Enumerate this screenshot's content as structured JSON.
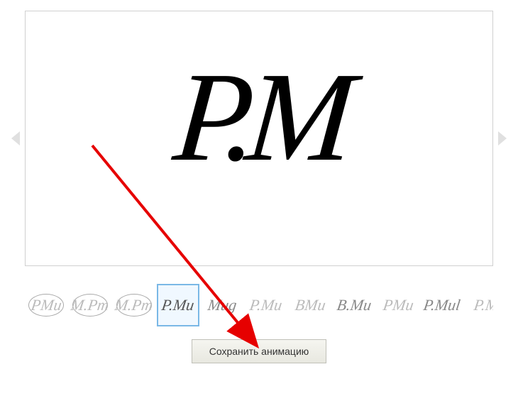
{
  "preview": {
    "signature_text": "P.M"
  },
  "thumbnails": [
    {
      "text": "PMu",
      "style": "oval lightest"
    },
    {
      "text": "M.Pm",
      "style": "oval lightest"
    },
    {
      "text": "M.Pm",
      "style": "oval lightest"
    },
    {
      "text": "P.Mu",
      "style": "darker",
      "selected": true
    },
    {
      "text": "Mug",
      "style": ""
    },
    {
      "text": "P.Mu",
      "style": "lightest"
    },
    {
      "text": "BMu",
      "style": "lightest"
    },
    {
      "text": "B.Mu",
      "style": ""
    },
    {
      "text": "PMu",
      "style": "lightest"
    },
    {
      "text": "P.Mul",
      "style": ""
    },
    {
      "text": "P.M",
      "style": "lightest"
    }
  ],
  "actions": {
    "save_label": "Сохранить анимацию"
  }
}
